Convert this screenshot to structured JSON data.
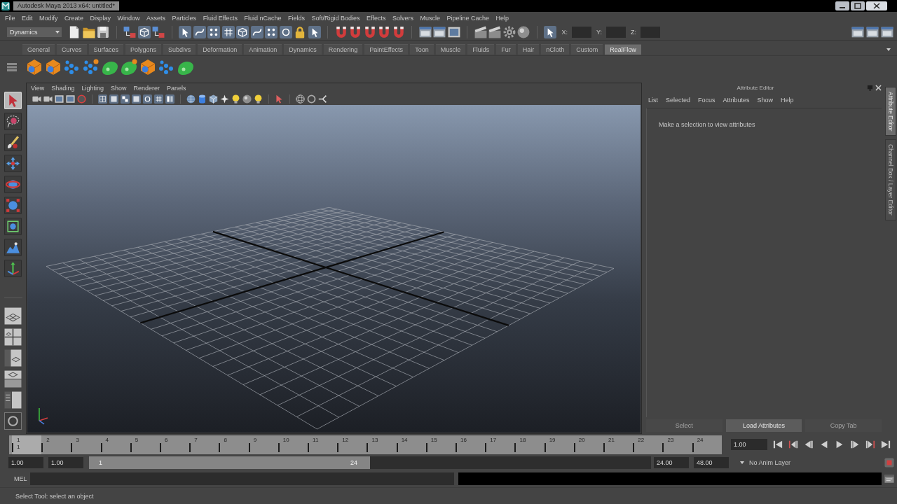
{
  "window": {
    "title": "Autodesk Maya 2013 x64: untitled*"
  },
  "menu_bar": [
    "File",
    "Edit",
    "Modify",
    "Create",
    "Display",
    "Window",
    "Assets",
    "Particles",
    "Fluid Effects",
    "Fluid nCache",
    "Fields",
    "Soft/Rigid Bodies",
    "Effects",
    "Solvers",
    "Muscle",
    "Pipeline Cache",
    "Help"
  ],
  "status_line": {
    "menu_set": "Dynamics",
    "coordinate_labels": [
      "X:",
      "Y:",
      "Z:"
    ]
  },
  "shelf": {
    "tabs": [
      {
        "label": "General",
        "selected": false
      },
      {
        "label": "Curves",
        "selected": false
      },
      {
        "label": "Surfaces",
        "selected": false
      },
      {
        "label": "Polygons",
        "selected": false
      },
      {
        "label": "Subdivs",
        "selected": false
      },
      {
        "label": "Deformation",
        "selected": false
      },
      {
        "label": "Animation",
        "selected": false
      },
      {
        "label": "Dynamics",
        "selected": false
      },
      {
        "label": "Rendering",
        "selected": false
      },
      {
        "label": "PaintEffects",
        "selected": false
      },
      {
        "label": "Toon",
        "selected": false
      },
      {
        "label": "Muscle",
        "selected": false
      },
      {
        "label": "Fluids",
        "selected": false
      },
      {
        "label": "Fur",
        "selected": false
      },
      {
        "label": "Hair",
        "selected": false
      },
      {
        "label": "nCloth",
        "selected": false
      },
      {
        "label": "Custom",
        "selected": false
      },
      {
        "label": "RealFlow",
        "selected": true
      }
    ]
  },
  "toolbox": [
    {
      "kind": "select",
      "selected": true
    },
    {
      "kind": "lasso",
      "selected": false
    },
    {
      "kind": "paint",
      "selected": false
    },
    {
      "kind": "move",
      "selected": false
    },
    {
      "kind": "rotate",
      "selected": false
    },
    {
      "kind": "scale",
      "selected": false
    },
    {
      "kind": "universal",
      "selected": false
    },
    {
      "kind": "softmod",
      "selected": false
    },
    {
      "kind": "manip",
      "selected": false
    }
  ],
  "viewport": {
    "menu": [
      "View",
      "Shading",
      "Lighting",
      "Show",
      "Renderer",
      "Panels"
    ]
  },
  "attribute_editor": {
    "title": "Attribute Editor",
    "menu": [
      "List",
      "Selected",
      "Focus",
      "Attributes",
      "Show",
      "Help"
    ],
    "message": "Make a selection to view attributes",
    "buttons": [
      {
        "label": "Select",
        "disabled": true
      },
      {
        "label": "Load Attributes",
        "disabled": false
      },
      {
        "label": "Copy Tab",
        "disabled": true
      }
    ]
  },
  "side_tabs": [
    {
      "label": "Attribute Editor",
      "selected": true
    },
    {
      "label": "Channel Box / Layer Editor",
      "selected": false
    }
  ],
  "time_slider": {
    "frames": [
      {
        "label": "1",
        "selected": true
      },
      {
        "label": "2",
        "selected": false
      },
      {
        "label": "3",
        "selected": false
      },
      {
        "label": "4",
        "selected": false
      },
      {
        "label": "5",
        "selected": false
      },
      {
        "label": "6",
        "selected": false
      },
      {
        "label": "7",
        "selected": false
      },
      {
        "label": "8",
        "selected": false
      },
      {
        "label": "9",
        "selected": false
      },
      {
        "label": "10",
        "selected": false
      },
      {
        "label": "11",
        "selected": false
      },
      {
        "label": "12",
        "selected": false
      },
      {
        "label": "13",
        "selected": false
      },
      {
        "label": "14",
        "selected": false
      },
      {
        "label": "15",
        "selected": false
      },
      {
        "label": "16",
        "selected": false
      },
      {
        "label": "17",
        "selected": false
      },
      {
        "label": "18",
        "selected": false
      },
      {
        "label": "19",
        "selected": false
      },
      {
        "label": "20",
        "selected": false
      },
      {
        "label": "21",
        "selected": false
      },
      {
        "label": "22",
        "selected": false
      },
      {
        "label": "23",
        "selected": false
      },
      {
        "label": "24",
        "selected": false
      }
    ],
    "current_frame": "1",
    "current_time": "1.00"
  },
  "range_slider": {
    "start_time": "1.00",
    "playback_start": "1.00",
    "range_start": "1",
    "range_end": "24",
    "level": 0.5,
    "playback_end": "24.00",
    "end_time": "48.00",
    "anim_layer": "No Anim Layer"
  },
  "command_line": {
    "language": "MEL"
  },
  "help_line": "Select Tool: select an object"
}
